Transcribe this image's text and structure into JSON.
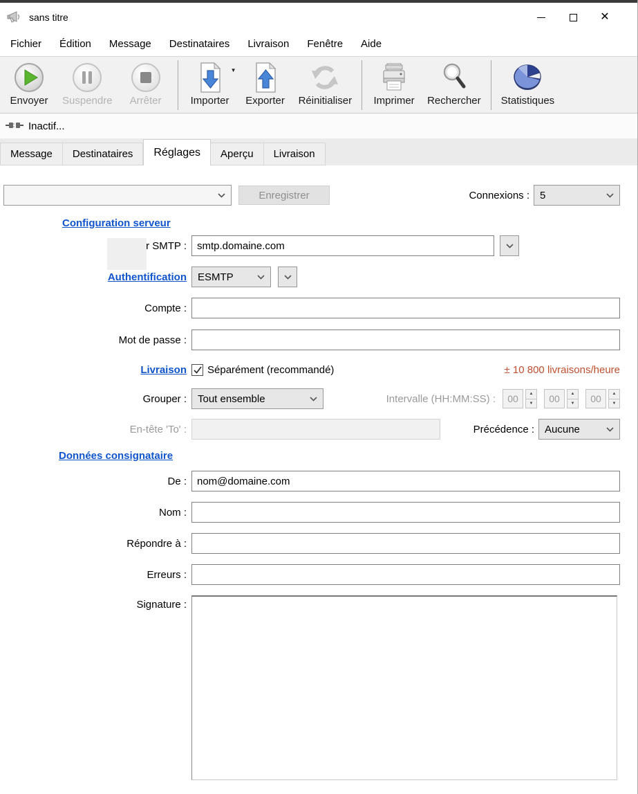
{
  "window": {
    "title": "sans titre"
  },
  "menu": {
    "items": [
      "Fichier",
      "Édition",
      "Message",
      "Destinataires",
      "Livraison",
      "Fenêtre",
      "Aide"
    ]
  },
  "toolbar": {
    "buttons": [
      {
        "label": "Envoyer",
        "icon": "play-circle",
        "enabled": true
      },
      {
        "label": "Suspendre",
        "icon": "pause-circle",
        "enabled": false
      },
      {
        "label": "Arrêter",
        "icon": "stop-circle",
        "enabled": false
      },
      {
        "label": "Importer",
        "icon": "document-arrow-down",
        "enabled": true,
        "has_dropdown": true
      },
      {
        "label": "Exporter",
        "icon": "document-arrow-up",
        "enabled": true
      },
      {
        "label": "Réinitialiser",
        "icon": "refresh-arrows",
        "enabled": true
      },
      {
        "label": "Imprimer",
        "icon": "printer",
        "enabled": true
      },
      {
        "label": "Rechercher",
        "icon": "magnifier",
        "enabled": true
      },
      {
        "label": "Statistiques",
        "icon": "pie-chart",
        "enabled": true
      }
    ]
  },
  "status": {
    "icon": "disconnected-plug",
    "text": "Inactif..."
  },
  "tabs": {
    "items": [
      "Message",
      "Destinataires",
      "Réglages",
      "Aperçu",
      "Livraison"
    ],
    "active": "Réglages"
  },
  "form": {
    "preset": {
      "value": "",
      "save_label": "Enregistrer"
    },
    "connections": {
      "label": "Connexions :",
      "value": "5"
    },
    "server_section": {
      "link": "Configuration serveur"
    },
    "smtp": {
      "label": "ur SMTP :",
      "value": "smtp.domaine.com"
    },
    "auth": {
      "link": "Authentification",
      "method": "ESMTP"
    },
    "account": {
      "label": "Compte :",
      "value": ""
    },
    "password": {
      "label": "Mot de passe :",
      "value": ""
    },
    "delivery": {
      "link": "Livraison",
      "checkbox_label": "Séparément (recommandé)",
      "checked": true,
      "rate": "± 10 800 livraisons/heure"
    },
    "group": {
      "label": "Grouper :",
      "value": "Tout ensemble"
    },
    "interval": {
      "label": "Intervalle (HH:MM:SS) :",
      "hh": "00",
      "mm": "00",
      "ss": "00"
    },
    "to_header": {
      "label": "En-tête 'To' :",
      "value": ""
    },
    "precedence": {
      "label": "Précédence :",
      "value": "Aucune"
    },
    "consignor_section": {
      "link": "Données consignataire"
    },
    "from": {
      "label": "De :",
      "value": "nom@domaine.com"
    },
    "name": {
      "label": "Nom :",
      "value": ""
    },
    "reply_to": {
      "label": "Répondre à :",
      "value": ""
    },
    "errors": {
      "label": "Erreurs :",
      "value": ""
    },
    "signature": {
      "label": "Signature :",
      "value": ""
    }
  },
  "colors": {
    "link_blue": "#1155cc",
    "rate_orange": "#c05030",
    "play_green": "#5cb52e",
    "arrow_blue": "#4a86d8"
  }
}
